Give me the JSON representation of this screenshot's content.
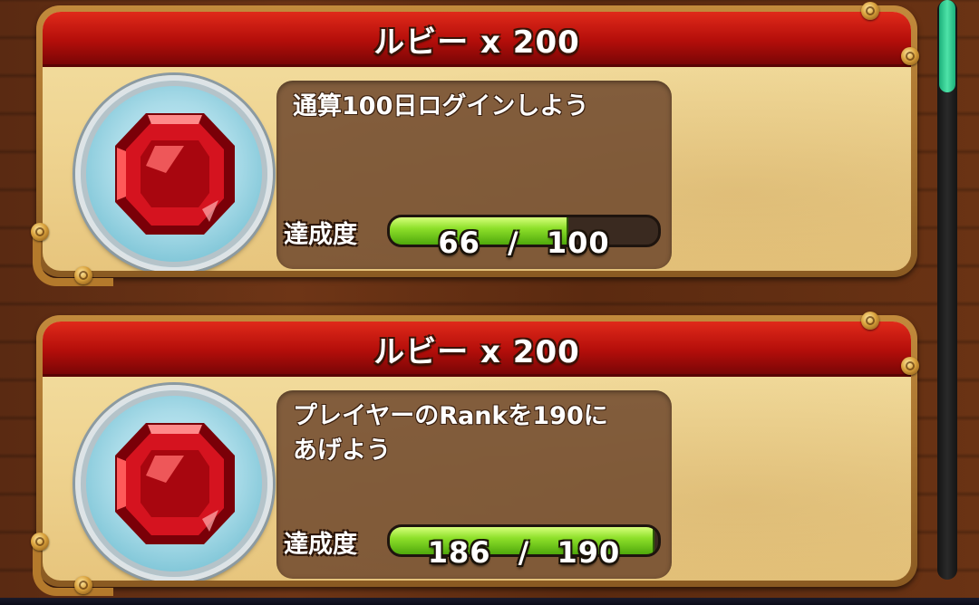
{
  "missions": [
    {
      "reward_title": "ルビー x 200",
      "reward_icon": "ruby-gem-icon",
      "description": "通算100日ログインしよう",
      "progress_label": "達成度",
      "current": "66",
      "separator": "/",
      "target": "100",
      "progress_fraction": 0.66
    },
    {
      "reward_title": "ルビー x 200",
      "reward_icon": "ruby-gem-icon",
      "description": "プレイヤーのRankを190に\nあげよう",
      "progress_label": "達成度",
      "current": "186",
      "separator": "/",
      "target": "190",
      "progress_fraction": 0.979
    }
  ],
  "scrollbar": {
    "thumb_fraction": 0.0
  },
  "colors": {
    "banner_red": "#c0140e",
    "progress_green": "#8ee02a",
    "medal_blue": "#a9dbe8",
    "parchment": "#efd491",
    "scroll_thumb": "#2fd08f"
  }
}
